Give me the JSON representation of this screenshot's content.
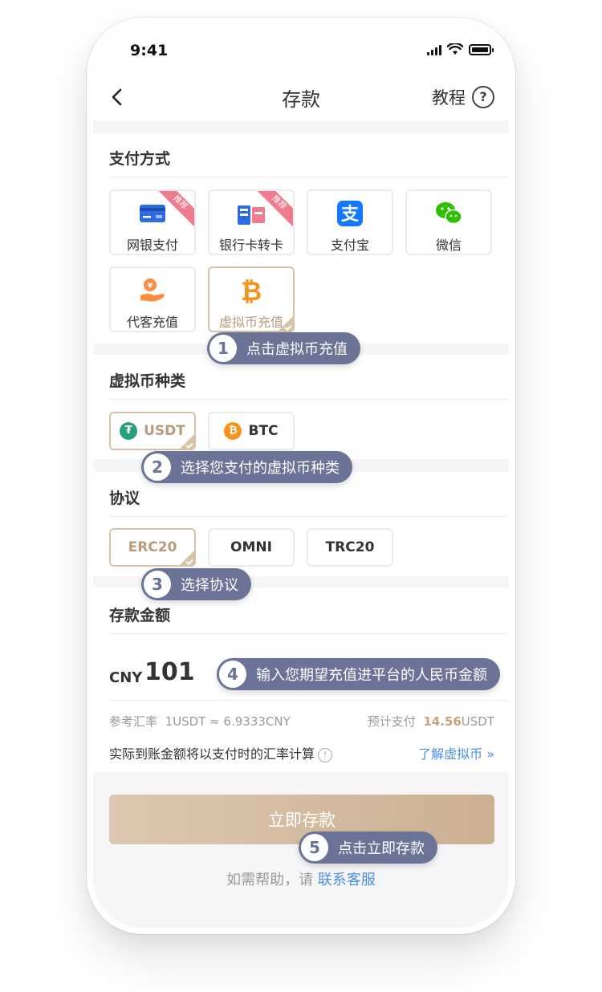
{
  "status": {
    "time": "9:41"
  },
  "nav": {
    "title": "存款",
    "tutorial": "教程",
    "help_icon": "?"
  },
  "payment": {
    "title": "支付方式",
    "methods": [
      {
        "label": "网银支付",
        "icon": "bank-card-icon",
        "badge": "推荐"
      },
      {
        "label": "银行卡转卡",
        "icon": "card-transfer-icon",
        "badge": "推荐"
      },
      {
        "label": "支付宝",
        "icon": "alipay-icon"
      },
      {
        "label": "微信",
        "icon": "wechat-icon"
      },
      {
        "label": "代客充值",
        "icon": "agent-recharge-icon"
      },
      {
        "label": "虚拟币充值",
        "icon": "bitcoin-icon",
        "selected": true
      }
    ]
  },
  "coin_type": {
    "title": "虚拟币种类",
    "options": [
      {
        "label": "USDT",
        "icon": "tether-icon",
        "icon_glyph": "₮",
        "selected": true
      },
      {
        "label": "BTC",
        "icon": "bitcoin-coin-icon",
        "icon_glyph": "₿"
      }
    ]
  },
  "protocol": {
    "title": "协议",
    "options": [
      {
        "label": "ERC20",
        "selected": true
      },
      {
        "label": "OMNI"
      },
      {
        "label": "TRC20"
      }
    ]
  },
  "amount": {
    "title": "存款金额",
    "currency": "CNY",
    "value": "101",
    "rate_label": "参考汇率",
    "rate_value": "1USDT ≈ 6.9333CNY",
    "estimate_label": "预计支付",
    "estimate_value": "14.56",
    "estimate_unit": "USDT",
    "note": "实际到账金额将以支付时的汇率计算",
    "learn_more": "了解虚拟币 »"
  },
  "submit": {
    "label": "立即存款"
  },
  "help": {
    "prefix": "如需帮助，请",
    "link": "联系客服"
  },
  "callouts": [
    {
      "num": "1",
      "text": "点击虚拟币充值"
    },
    {
      "num": "2",
      "text": "选择您支付的虚拟币种类"
    },
    {
      "num": "3",
      "text": "选择协议"
    },
    {
      "num": "4",
      "text": "输入您期望充值进平台的人民币金额"
    },
    {
      "num": "5",
      "text": "点击立即存款"
    }
  ],
  "colors": {
    "accent": "#c7a27a",
    "callout": "#6b7396",
    "link": "#4a90e2",
    "badge": "#f07a8e"
  }
}
